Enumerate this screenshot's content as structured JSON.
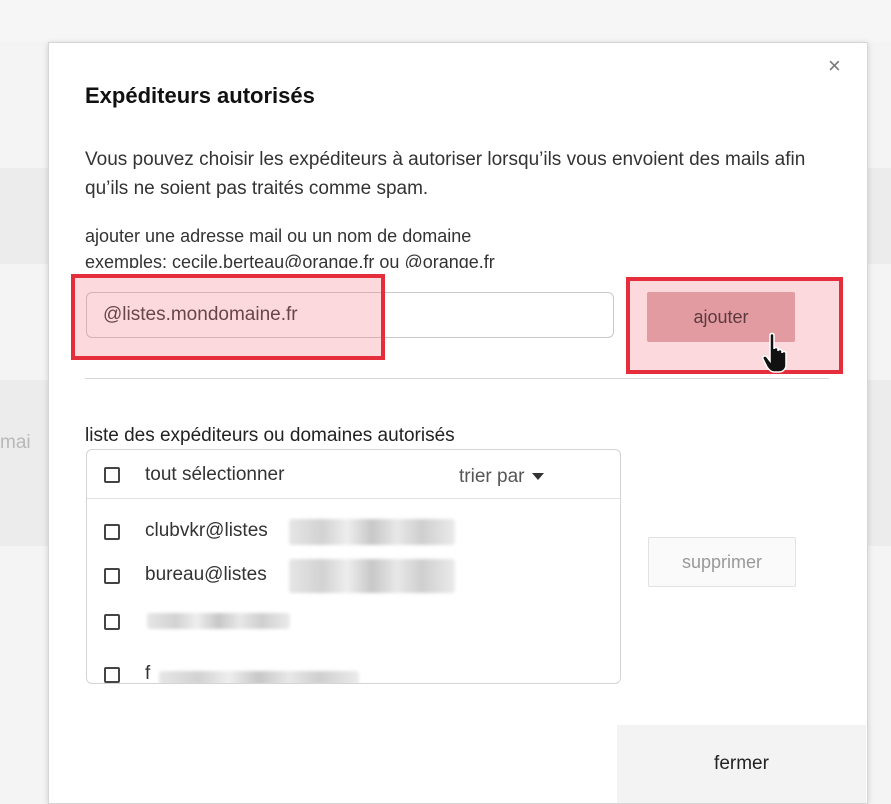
{
  "background": {
    "fragment": "mai"
  },
  "dialog": {
    "close_glyph": "×",
    "title": "Expéditeurs autorisés",
    "description": "Vous pouvez choisir les expéditeurs à autoriser lorsqu’ils vous envoient des mails afin qu’ils ne soient pas traités comme spam.",
    "hint": "ajouter une adresse mail ou un nom de domaine",
    "example": "exemples: cecile.berteau@orange.fr ou @orange.fr",
    "input_value": "@listes.mondomaine.fr",
    "add_label": "ajouter",
    "highlight_color": "#e52d3b",
    "list": {
      "label": "liste des expéditeurs ou domaines autorisés",
      "select_all": "tout sélectionner",
      "sort_label": "trier par",
      "items": [
        {
          "prefix": "clubvkr@listes"
        },
        {
          "prefix": "bureau@listes"
        },
        {
          "prefix": ""
        },
        {
          "prefix": "f"
        }
      ]
    },
    "delete_label": "supprimer",
    "close_label": "fermer"
  }
}
